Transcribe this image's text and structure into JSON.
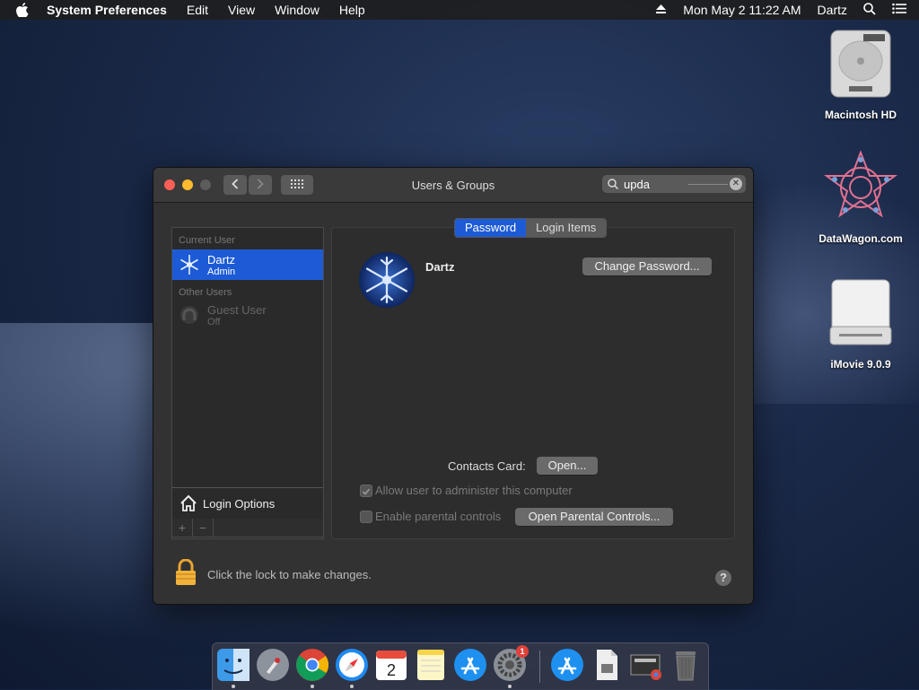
{
  "menubar": {
    "app": "System Preferences",
    "items": [
      "Edit",
      "View",
      "Window",
      "Help"
    ],
    "datetime": "Mon May 2  11:22 AM",
    "user": "Dartz"
  },
  "desktop": {
    "icons": [
      {
        "label": "Macintosh HD"
      },
      {
        "label": "DataWagon.com"
      },
      {
        "label": "iMovie 9.0.9"
      }
    ]
  },
  "window": {
    "title": "Users & Groups",
    "search_value": "upda"
  },
  "sidebar": {
    "current_header": "Current User",
    "current_user": {
      "name": "Dartz",
      "role": "Admin"
    },
    "other_header": "Other Users",
    "other_user": {
      "name": "Guest User",
      "status": "Off"
    },
    "login_options": "Login Options",
    "add": "+",
    "remove": "−"
  },
  "panel": {
    "tabs": [
      "Password",
      "Login Items"
    ],
    "selected_tab": "Password",
    "username": "Dartz",
    "change_password": "Change Password...",
    "contacts_label": "Contacts Card:",
    "open": "Open...",
    "admin_checkbox": "Allow user to administer this computer",
    "admin_checked": true,
    "parental_checkbox": "Enable parental controls",
    "parental_checked": false,
    "open_parental": "Open Parental Controls..."
  },
  "footer": {
    "lock_text": "Click the lock to make changes.",
    "help": "?"
  },
  "dock": {
    "settings_badge": "1"
  },
  "colors": {
    "accent": "#1d5bd6",
    "window_bg": "#323232"
  }
}
